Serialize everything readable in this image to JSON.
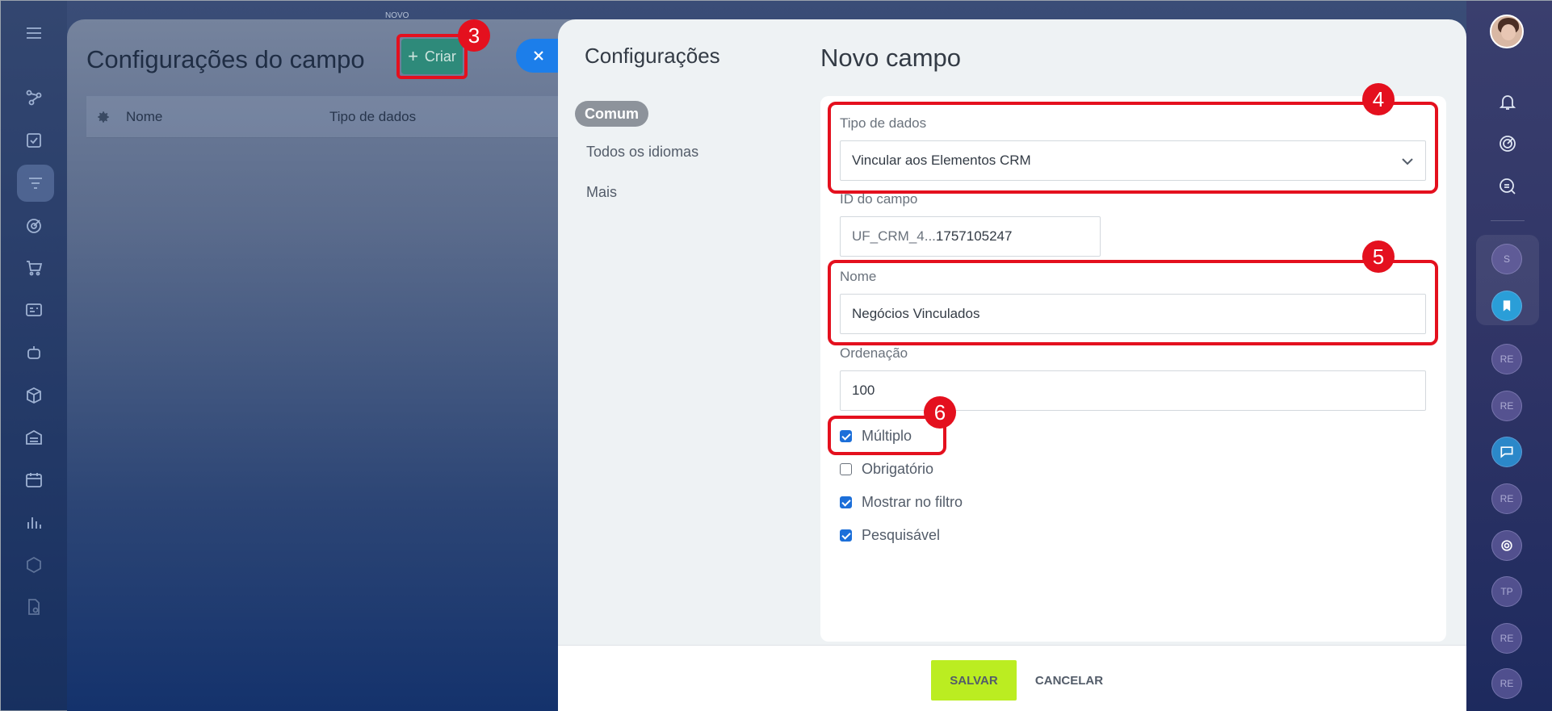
{
  "top_tag": "NOVO",
  "back_panel": {
    "title": "Configurações do campo",
    "create_button": "Criar",
    "table_columns": [
      "Nome",
      "Tipo de dados"
    ]
  },
  "sidebar": {
    "title": "Configurações",
    "items": [
      {
        "label": "Comum",
        "active": true
      },
      {
        "label": "Todos os idiomas",
        "active": false
      },
      {
        "label": "Mais",
        "active": false
      }
    ]
  },
  "form": {
    "title": "Novo campo",
    "data_type": {
      "label": "Tipo de dados",
      "value": "Vincular aos Elementos CRM"
    },
    "field_id": {
      "label": "ID do campo",
      "prefix": "UF_CRM_4...",
      "value": "1757105247"
    },
    "name": {
      "label": "Nome",
      "value": "Negócios Vinculados"
    },
    "sort": {
      "label": "Ordenação",
      "value": "100"
    },
    "checkboxes": [
      {
        "label": "Múltiplo",
        "checked": true
      },
      {
        "label": "Obrigatório",
        "checked": false
      },
      {
        "label": "Mostrar no filtro",
        "checked": true
      },
      {
        "label": "Pesquisável",
        "checked": true
      }
    ]
  },
  "footer": {
    "save": "SALVAR",
    "cancel": "CANCELAR"
  },
  "annotations": [
    "3",
    "4",
    "5",
    "6"
  ],
  "right_rail": {
    "circles": [
      "S",
      "RE",
      "RE",
      "RE",
      "TP",
      "RE",
      "RE"
    ]
  },
  "colors": {
    "highlight": "#e4101e",
    "save_button": "#bbed21",
    "create_button": "#2e8a7a",
    "checkbox": "#1c6fd9"
  }
}
